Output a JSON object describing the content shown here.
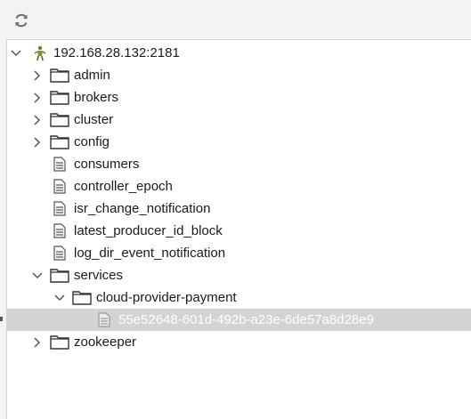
{
  "toolbar": {
    "refresh_icon": "refresh-icon"
  },
  "tree": {
    "root": {
      "label": "192.168.28.132:2181",
      "icon": "zookeeper-root-icon",
      "expanded": true
    },
    "nodes": [
      {
        "label": "admin",
        "type": "folder",
        "expanded": false
      },
      {
        "label": "brokers",
        "type": "folder",
        "expanded": false
      },
      {
        "label": "cluster",
        "type": "folder",
        "expanded": false
      },
      {
        "label": "config",
        "type": "folder",
        "expanded": false
      },
      {
        "label": "consumers",
        "type": "leaf"
      },
      {
        "label": "controller_epoch",
        "type": "leaf"
      },
      {
        "label": "isr_change_notification",
        "type": "leaf"
      },
      {
        "label": "latest_producer_id_block",
        "type": "leaf"
      },
      {
        "label": "log_dir_event_notification",
        "type": "leaf"
      },
      {
        "label": "services",
        "type": "folder",
        "expanded": true,
        "children": [
          {
            "label": "cloud-provider-payment",
            "type": "folder",
            "expanded": true,
            "children": [
              {
                "label": "55e52648-601d-492b-a23e-6de57a8d28e9",
                "type": "leaf",
                "selected": true
              }
            ]
          }
        ]
      },
      {
        "label": "zookeeper",
        "type": "folder",
        "expanded": false
      }
    ]
  },
  "colors": {
    "selection_bg": "#d3d3d3",
    "panel_bg": "#ffffff",
    "toolbar_bg": "#f3f3f3"
  }
}
